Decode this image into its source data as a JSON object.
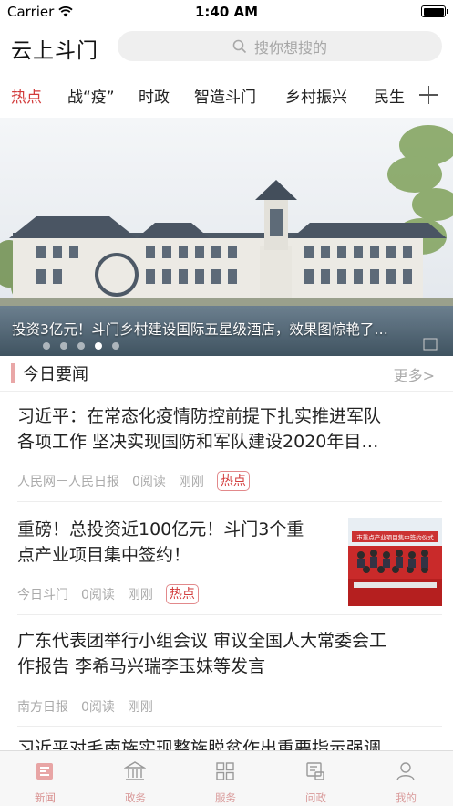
{
  "status_bar": {
    "carrier": "Carrier",
    "time": "1:40 AM"
  },
  "header": {
    "app_title": "云上斗门",
    "search_placeholder": "搜你想搜的"
  },
  "tabs": [
    "热点",
    "战“疫”",
    "时政",
    "智造斗门",
    "乡村振兴",
    "民生"
  ],
  "active_tab": 0,
  "banner": {
    "caption": "投资3亿元！斗门乡村建设国际五星级酒店，效果图惊艳了…",
    "slide_count": 5,
    "active_slide": 3
  },
  "section": {
    "title": "今日要闻",
    "more": "更多>"
  },
  "news": [
    {
      "title_line1": "习近平：在常态化疫情防控前提下扎实推进军队",
      "title_line2": "各项工作 坚决实现国防和军队建设2020年目…",
      "source": "人民网－人民日报",
      "reads": "0阅读",
      "time": "刚刚",
      "badge": "热点"
    },
    {
      "title_line1": "重磅！总投资近100亿元！斗门3个重",
      "title_line2": "点产业项目集中签约！",
      "source": "今日斗门",
      "reads": "0阅读",
      "time": "刚刚",
      "badge": "热点",
      "thumb_banner": "市重点产业项目集中签约仪式"
    },
    {
      "title_line1": "广东代表团举行小组会议 审议全国人大常委会工",
      "title_line2": "作报告 李希马兴瑞李玉妹等发言",
      "source": "南方日报",
      "reads": "0阅读",
      "time": "刚刚"
    },
    {
      "title_line1": "习近平对毛南族实现整族脱贫作出重要指示强调"
    }
  ],
  "bottom_nav": [
    {
      "label": "新闻",
      "icon": "news-icon"
    },
    {
      "label": "政务",
      "icon": "government-icon"
    },
    {
      "label": "服务",
      "icon": "grid-icon"
    },
    {
      "label": "问政",
      "icon": "inquiry-icon"
    },
    {
      "label": "我的",
      "icon": "user-icon"
    }
  ],
  "colors": {
    "accent": "#d23b3b",
    "nav_label": "#d99a9a",
    "badge_border": "#e2898b"
  }
}
